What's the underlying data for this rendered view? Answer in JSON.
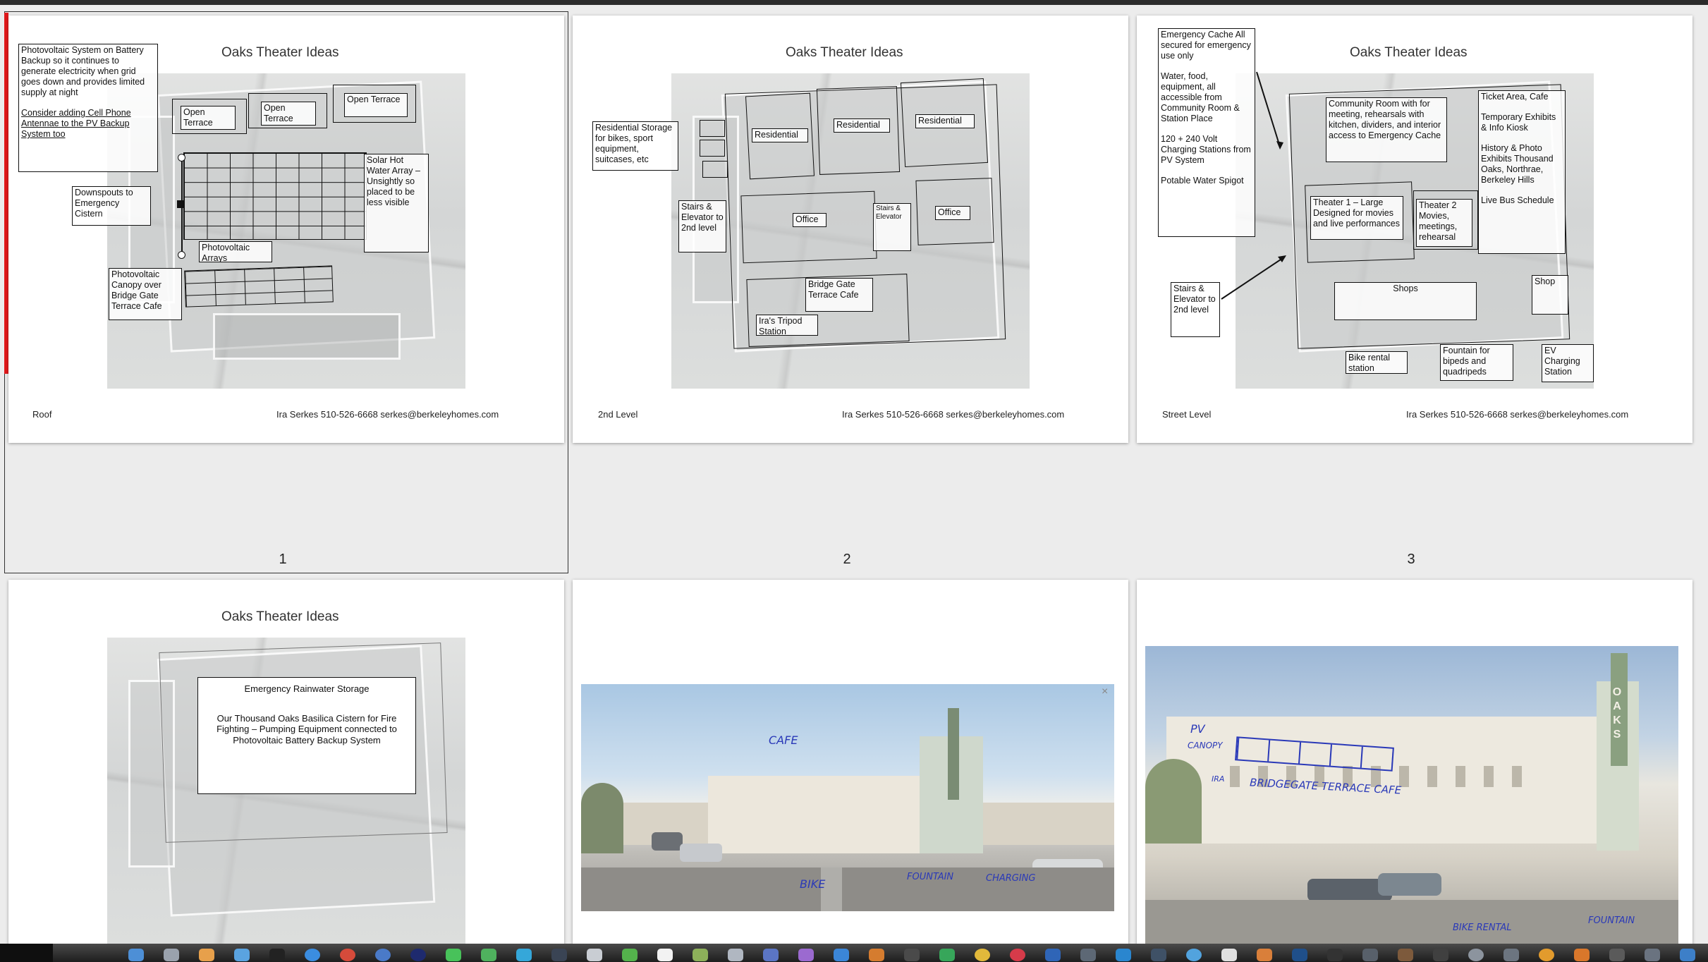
{
  "pages": [
    {
      "number": "1",
      "title": "Oaks Theater Ideas",
      "level": "Roof",
      "contact": "Ira Serkes 510-526-6668 serkes@berkeleyhomes.com",
      "pv_note": "Photovoltaic System on Battery Backup so it continues to generate electricity when grid goes down and provides limited supply at night",
      "antenna_note": "Consider adding Cell Phone Antennae to the PV Backup System too",
      "terrace_1": "Open Terrace",
      "terrace_2": "Open Terrace",
      "terrace_3": "Open Terrace",
      "downspouts": "Downspouts to Emergency Cistern",
      "solar_hot_water": "Solar Hot Water Array – Unsightly so placed to be less visible",
      "pv_arrays": "Photovoltaic Arrays",
      "pv_canopy": "Photovoltaic Canopy over Bridge Gate Terrace Cafe"
    },
    {
      "number": "2",
      "title": "Oaks Theater Ideas",
      "level": "2nd Level",
      "contact": "Ira Serkes 510-526-6668 serkes@berkeleyhomes.com",
      "storage": "Residential Storage for bikes, sport equipment, suitcases, etc",
      "stairs": "Stairs & Elevator to 2nd level",
      "residential_1": "Residential",
      "residential_2": "Residential",
      "residential_3": "Residential",
      "office_1": "Office",
      "stairs_elevator": "Stairs & Elevator",
      "office_2": "Office",
      "bridge_gate": "Bridge Gate Terrace Cafe",
      "tripod": "Ira's Tripod Station"
    },
    {
      "number": "3",
      "title": "Oaks Theater Ideas",
      "level": "Street Level",
      "contact": "Ira Serkes 510-526-6668 serkes@berkeleyhomes.com",
      "emergency_cache": "Emergency Cache All secured for emergency use only",
      "water_food": "Water, food, equipment, all accessible from Community Room & Station Place",
      "charging": "120 + 240 Volt Charging Stations from PV System",
      "potable": "Potable Water Spigot",
      "community_room": "Community Room with for meeting, rehearsals with kitchen, dividers, and interior access to Emergency Cache",
      "ticket_area": "Ticket Area, Cafe",
      "temp_exhibits": "Temporary Exhibits & Info Kiosk",
      "history": "History & Photo Exhibits Thousand Oaks, Northrae, Berkeley Hills",
      "live_bus": "Live Bus Schedule",
      "theater_1": "Theater 1 – Large Designed for movies and live performances",
      "theater_2": "Theater 2 Movies, meetings, rehearsal",
      "stairs": "Stairs & Elevator to 2nd level",
      "shops": "Shops",
      "shop": "Shop",
      "bike_rental": "Bike rental station",
      "fountain": "Fountain for bipeds and quadripeds",
      "ev": "EV Charging Station"
    },
    {
      "title": "Oaks Theater Ideas",
      "rainwater_title": "Emergency Rainwater Storage",
      "rainwater_body": "Our Thousand Oaks Basilica Cistern for Fire Fighting – Pumping Equipment connected to Photovoltaic Battery Backup System"
    },
    {
      "hw_cafe": "CAFE",
      "hw_bike": "BIKE",
      "hw_fountain": "FOUNTAIN",
      "hw_charging": "CHARGING",
      "close_glyph": "×"
    },
    {
      "hw_pv": "PV",
      "hw_canopy": "CANOPY",
      "hw_bridgegate": "BRIDGEGATE TERRACE CAFE",
      "hw_ira": "IRA",
      "hw_bike_rental": "BIKE RENTAL",
      "hw_fountain": "FOUNTAIN",
      "sign": "OAKS"
    }
  ],
  "colors": {
    "accent_red": "#e0191b",
    "handwriting": "#2a39b8"
  }
}
